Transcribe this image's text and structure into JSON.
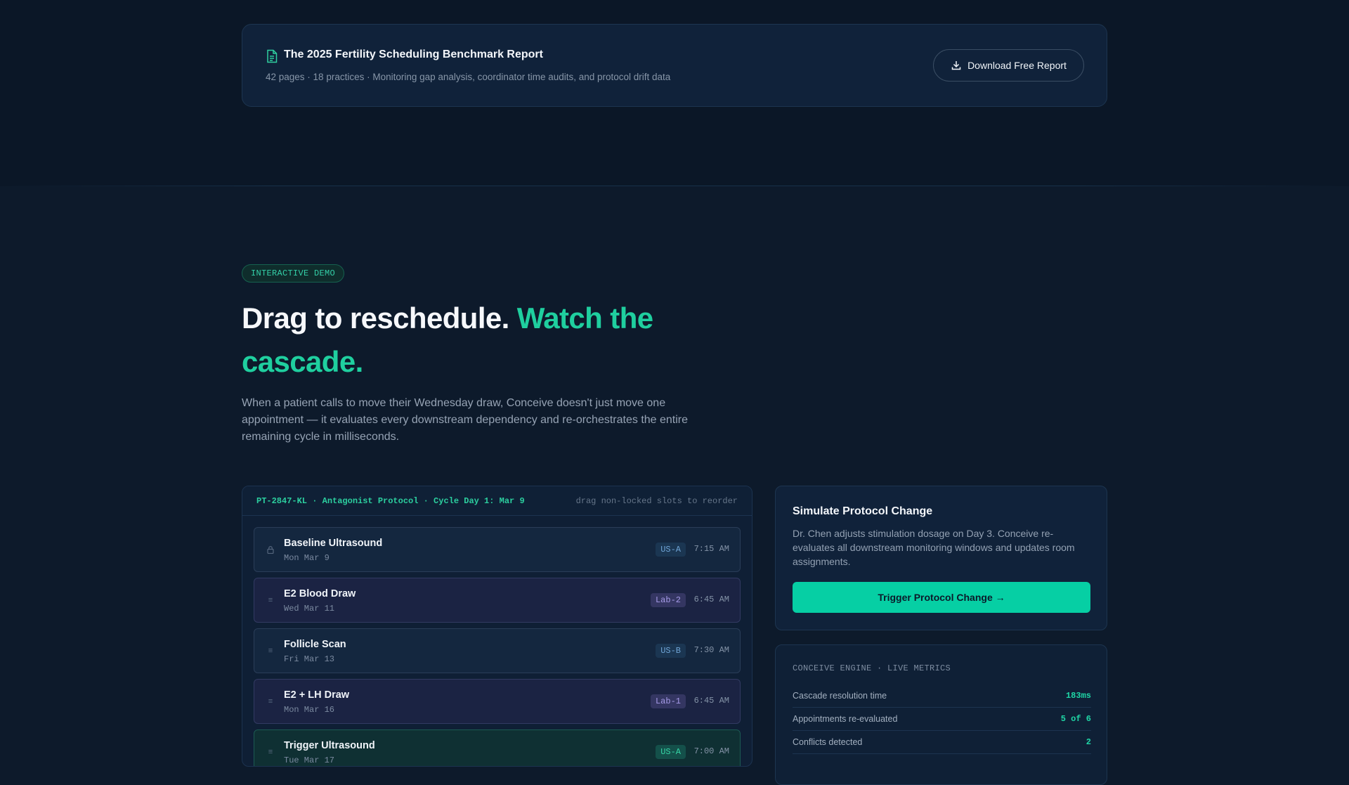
{
  "report": {
    "title": "The 2025 Fertility Scheduling Benchmark Report",
    "meta": "42 pages · 18 practices · Monitoring gap analysis, coordinator time audits, and protocol drift data",
    "download_label": "Download Free Report"
  },
  "demo": {
    "badge": "INTERACTIVE DEMO",
    "headline_main": "Drag to reschedule.",
    "headline_accent": "Watch the cascade.",
    "lede": "When a patient calls to move their Wednesday draw, Conceive doesn't just move one appointment — it evaluates every downstream dependency and re-orchestrates the entire remaining cycle in milliseconds."
  },
  "schedule": {
    "patient_header": "PT-2847-KL · Antagonist Protocol · Cycle Day 1: Mar 9",
    "hint": "drag non-locked slots to reorder",
    "slots": [
      {
        "title": "Baseline Ultrasound",
        "date": "Mon Mar 9",
        "room": "US-A",
        "time": "7:15 AM",
        "locked": true
      },
      {
        "title": "E2 Blood Draw",
        "date": "Wed Mar 11",
        "room": "Lab-2",
        "time": "6:45 AM",
        "locked": false
      },
      {
        "title": "Follicle Scan",
        "date": "Fri Mar 13",
        "room": "US-B",
        "time": "7:30 AM",
        "locked": false
      },
      {
        "title": "E2 + LH Draw",
        "date": "Mon Mar 16",
        "room": "Lab-1",
        "time": "6:45 AM",
        "locked": false
      },
      {
        "title": "Trigger Ultrasound",
        "date": "Tue Mar 17",
        "room": "US-A",
        "time": "7:00 AM",
        "locked": false
      }
    ]
  },
  "simulate": {
    "title": "Simulate Protocol Change",
    "description": "Dr. Chen adjusts stimulation dosage on Day 3. Conceive re-evaluates all downstream monitoring windows and updates room assignments.",
    "button_label": "Trigger Protocol Change →"
  },
  "metrics": {
    "title": "CONCEIVE ENGINE · LIVE METRICS",
    "rows": [
      {
        "label": "Cascade resolution time",
        "value": "183ms"
      },
      {
        "label": "Appointments re-evaluated",
        "value": "5 of 6"
      },
      {
        "label": "Conflicts detected",
        "value": "2"
      }
    ]
  },
  "colors": {
    "accent": "#1fcf9f",
    "background": "#0d1a2b",
    "button": "#06cfa4"
  }
}
